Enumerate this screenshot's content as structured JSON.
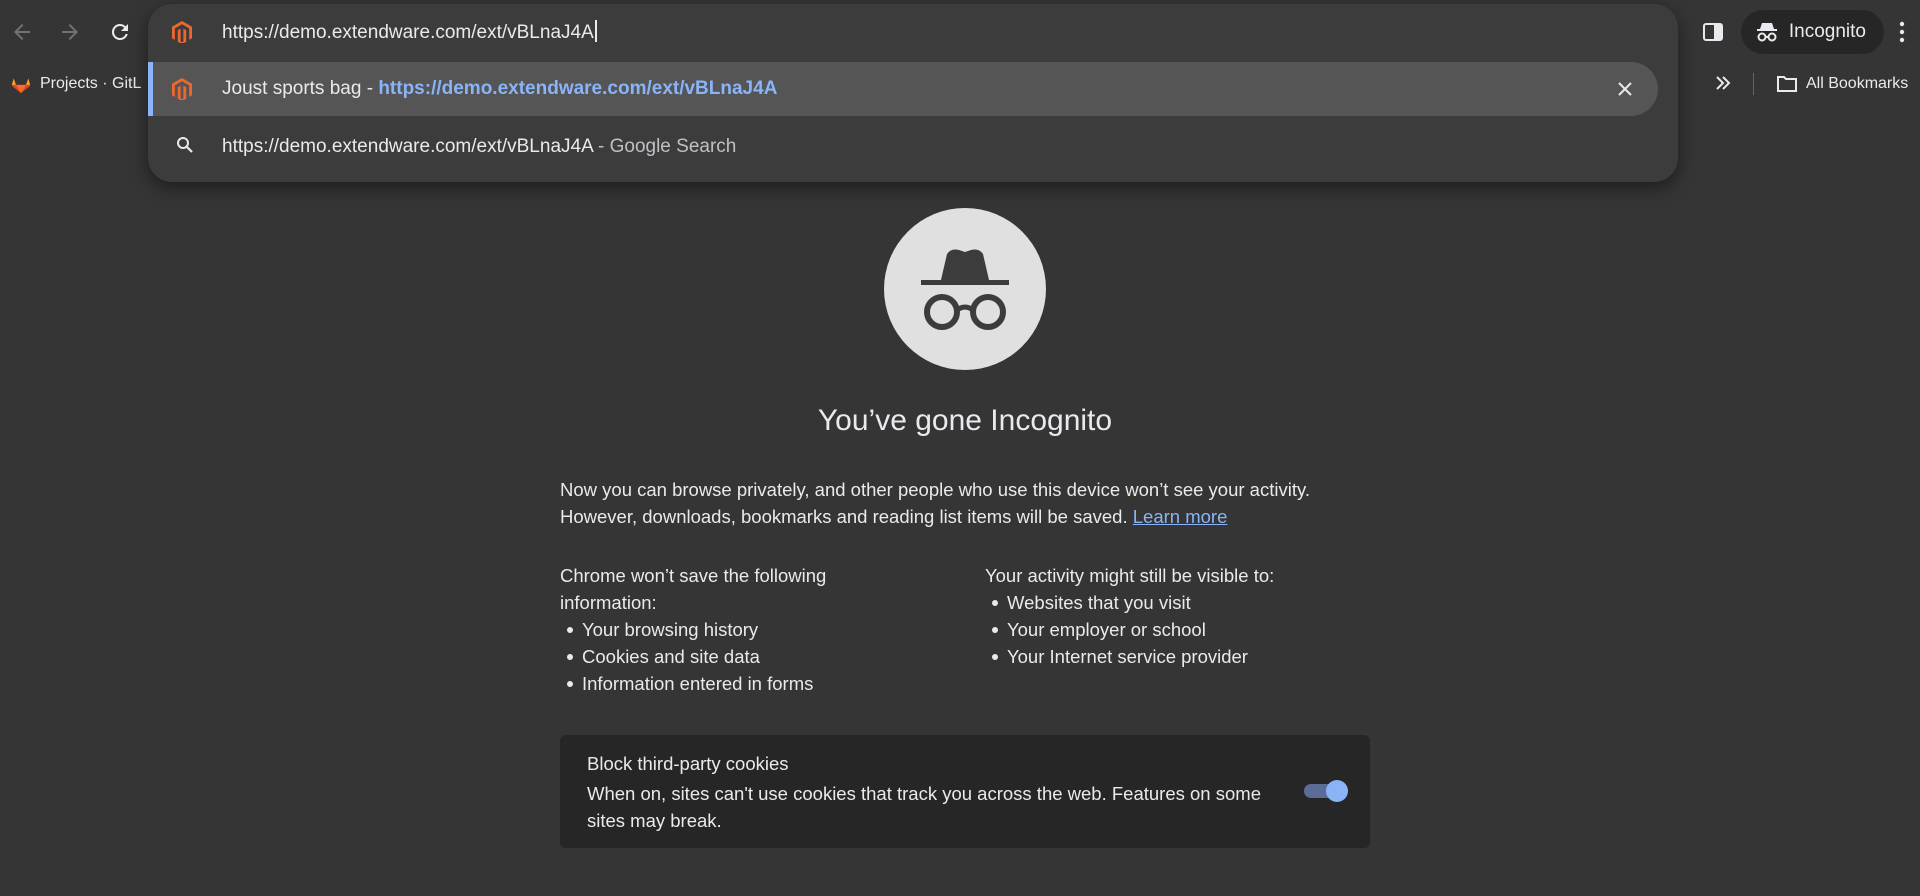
{
  "toolbar": {
    "back_icon": "arrow-left-icon",
    "forward_icon": "arrow-right-icon",
    "reload_icon": "reload-icon",
    "incognito_label": "Incognito"
  },
  "bookmarks_bar": {
    "items": [
      {
        "label": "Projects · GitL",
        "icon": "gitlab-icon"
      }
    ],
    "all_bookmarks_label": "All Bookmarks"
  },
  "omnibox": {
    "input_value": "https://demo.extendware.com/ext/vBLnaJ4A",
    "suggestions": [
      {
        "title": "Joust sports bag",
        "separator": " - ",
        "url": "https://demo.extendware.com/ext/vBLnaJ4A",
        "selected": true
      },
      {
        "query": "https://demo.extendware.com/ext/vBLnaJ4A",
        "suffix": " - Google Search"
      }
    ]
  },
  "page": {
    "title": "You’ve gone Incognito",
    "intro_line1": "Now you can browse privately, and other people who use this device won’t see your activity.",
    "intro_line2": "However, downloads, bookmarks and reading list items will be saved.",
    "learn_more": "Learn more",
    "left_heading": "Chrome won’t save the following information:",
    "left_items": [
      "Your browsing history",
      "Cookies and site data",
      "Information entered in forms"
    ],
    "right_heading_prefix": "Your activity ",
    "right_heading_bold": "might still be visible",
    "right_heading_suffix": " to:",
    "right_items": [
      "Websites that you visit",
      "Your employer or school",
      "Your Internet service provider"
    ],
    "cookie_card": {
      "title": "Block third-party cookies",
      "description": "When on, sites can't use cookies that track you across the web. Features on some sites may break.",
      "toggle_on": true
    }
  },
  "colors": {
    "background": "#353535",
    "omnibox": "#3c3c3c",
    "accent": "#8ab4f8",
    "magento_orange": "#ee672f"
  }
}
